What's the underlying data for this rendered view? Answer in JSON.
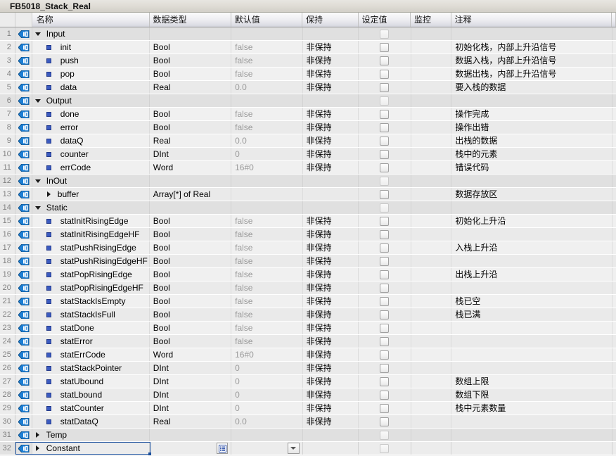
{
  "window": {
    "title": "FB5018_Stack_Real"
  },
  "table": {
    "columns": [
      {
        "key": "num",
        "label": ""
      },
      {
        "key": "icon",
        "label": ""
      },
      {
        "key": "name",
        "label": "名称"
      },
      {
        "key": "type",
        "label": "数据类型"
      },
      {
        "key": "def",
        "label": "默认值"
      },
      {
        "key": "ret",
        "label": "保持"
      },
      {
        "key": "set",
        "label": "设定值"
      },
      {
        "key": "mon",
        "label": "监控"
      },
      {
        "key": "com",
        "label": "注释"
      }
    ],
    "retain_value": "非保持",
    "icon_name": "variable-tag-icon",
    "rows": [
      {
        "n": "1",
        "kind": "section",
        "expanded": true,
        "indent": 0,
        "name": "Input",
        "type": "",
        "def": "",
        "ret": "",
        "com": ""
      },
      {
        "n": "2",
        "kind": "var",
        "expanded": false,
        "indent": 1,
        "name": "init",
        "type": "Bool",
        "def": "false",
        "ret": "非保持",
        "com": "初始化栈，内部上升沿信号"
      },
      {
        "n": "3",
        "kind": "var",
        "expanded": false,
        "indent": 1,
        "name": "push",
        "type": "Bool",
        "def": "false",
        "ret": "非保持",
        "com": "数据入栈，内部上升沿信号"
      },
      {
        "n": "4",
        "kind": "var",
        "expanded": false,
        "indent": 1,
        "name": "pop",
        "type": "Bool",
        "def": "false",
        "ret": "非保持",
        "com": "数据出栈，内部上升沿信号"
      },
      {
        "n": "5",
        "kind": "var",
        "expanded": false,
        "indent": 1,
        "name": "data",
        "type": "Real",
        "def": "0.0",
        "ret": "非保持",
        "com": "要入栈的数据"
      },
      {
        "n": "6",
        "kind": "section",
        "expanded": true,
        "indent": 0,
        "name": "Output",
        "type": "",
        "def": "",
        "ret": "",
        "com": ""
      },
      {
        "n": "7",
        "kind": "var",
        "expanded": false,
        "indent": 1,
        "name": "done",
        "type": "Bool",
        "def": "false",
        "ret": "非保持",
        "com": "操作完成"
      },
      {
        "n": "8",
        "kind": "var",
        "expanded": false,
        "indent": 1,
        "name": "error",
        "type": "Bool",
        "def": "false",
        "ret": "非保持",
        "com": "操作出错"
      },
      {
        "n": "9",
        "kind": "var",
        "expanded": false,
        "indent": 1,
        "name": "dataQ",
        "type": "Real",
        "def": "0.0",
        "ret": "非保持",
        "com": "出栈的数据"
      },
      {
        "n": "10",
        "kind": "var",
        "expanded": false,
        "indent": 1,
        "name": "counter",
        "type": "DInt",
        "def": "0",
        "ret": "非保持",
        "com": "栈中的元素"
      },
      {
        "n": "11",
        "kind": "var",
        "expanded": false,
        "indent": 1,
        "name": "errCode",
        "type": "Word",
        "def": "16#0",
        "ret": "非保持",
        "com": "错误代码"
      },
      {
        "n": "12",
        "kind": "section",
        "expanded": true,
        "indent": 0,
        "name": "InOut",
        "type": "",
        "def": "",
        "ret": "",
        "com": ""
      },
      {
        "n": "13",
        "kind": "var",
        "expanded": false,
        "indent": 1,
        "name": "buffer",
        "type": "Array[*] of Real",
        "def": "",
        "ret": "",
        "com": "数据存放区",
        "collapsible": true
      },
      {
        "n": "14",
        "kind": "section",
        "expanded": true,
        "indent": 0,
        "name": "Static",
        "type": "",
        "def": "",
        "ret": "",
        "com": ""
      },
      {
        "n": "15",
        "kind": "var",
        "expanded": false,
        "indent": 1,
        "name": "statInitRisingEdge",
        "type": "Bool",
        "def": "false",
        "ret": "非保持",
        "com": "初始化上升沿"
      },
      {
        "n": "16",
        "kind": "var",
        "expanded": false,
        "indent": 1,
        "name": "statInitRisingEdgeHF",
        "type": "Bool",
        "def": "false",
        "ret": "非保持",
        "com": ""
      },
      {
        "n": "17",
        "kind": "var",
        "expanded": false,
        "indent": 1,
        "name": "statPushRisingEdge",
        "type": "Bool",
        "def": "false",
        "ret": "非保持",
        "com": "入栈上升沿"
      },
      {
        "n": "18",
        "kind": "var",
        "expanded": false,
        "indent": 1,
        "name": "statPushRisingEdgeHF",
        "type": "Bool",
        "def": "false",
        "ret": "非保持",
        "com": ""
      },
      {
        "n": "19",
        "kind": "var",
        "expanded": false,
        "indent": 1,
        "name": "statPopRisingEdge",
        "type": "Bool",
        "def": "false",
        "ret": "非保持",
        "com": "出栈上升沿"
      },
      {
        "n": "20",
        "kind": "var",
        "expanded": false,
        "indent": 1,
        "name": "statPopRisingEdgeHF",
        "type": "Bool",
        "def": "false",
        "ret": "非保持",
        "com": ""
      },
      {
        "n": "21",
        "kind": "var",
        "expanded": false,
        "indent": 1,
        "name": "statStackIsEmpty",
        "type": "Bool",
        "def": "false",
        "ret": "非保持",
        "com": "栈已空"
      },
      {
        "n": "22",
        "kind": "var",
        "expanded": false,
        "indent": 1,
        "name": "statStackIsFull",
        "type": "Bool",
        "def": "false",
        "ret": "非保持",
        "com": "栈已满"
      },
      {
        "n": "23",
        "kind": "var",
        "expanded": false,
        "indent": 1,
        "name": "statDone",
        "type": "Bool",
        "def": "false",
        "ret": "非保持",
        "com": ""
      },
      {
        "n": "24",
        "kind": "var",
        "expanded": false,
        "indent": 1,
        "name": "statError",
        "type": "Bool",
        "def": "false",
        "ret": "非保持",
        "com": ""
      },
      {
        "n": "25",
        "kind": "var",
        "expanded": false,
        "indent": 1,
        "name": "statErrCode",
        "type": "Word",
        "def": "16#0",
        "ret": "非保持",
        "com": ""
      },
      {
        "n": "26",
        "kind": "var",
        "expanded": false,
        "indent": 1,
        "name": "statStackPointer",
        "type": "DInt",
        "def": "0",
        "ret": "非保持",
        "com": ""
      },
      {
        "n": "27",
        "kind": "var",
        "expanded": false,
        "indent": 1,
        "name": "statUbound",
        "type": "DInt",
        "def": "0",
        "ret": "非保持",
        "com": "数组上限"
      },
      {
        "n": "28",
        "kind": "var",
        "expanded": false,
        "indent": 1,
        "name": "statLbound",
        "type": "DInt",
        "def": "0",
        "ret": "非保持",
        "com": "数组下限"
      },
      {
        "n": "29",
        "kind": "var",
        "expanded": false,
        "indent": 1,
        "name": "statCounter",
        "type": "DInt",
        "def": "0",
        "ret": "非保持",
        "com": "栈中元素数量"
      },
      {
        "n": "30",
        "kind": "var",
        "expanded": false,
        "indent": 1,
        "name": "statDataQ",
        "type": "Real",
        "def": "0.0",
        "ret": "非保持",
        "com": ""
      },
      {
        "n": "31",
        "kind": "section",
        "expanded": false,
        "indent": 0,
        "name": "Temp",
        "type": "",
        "def": "",
        "ret": "",
        "com": ""
      },
      {
        "n": "32",
        "kind": "section",
        "expanded": false,
        "indent": 0,
        "name": "Constant",
        "type": "",
        "def": "",
        "ret": "",
        "com": "",
        "selected": true
      }
    ]
  },
  "colors": {
    "accent": "#1a4f9c",
    "tag_icon": "#1e7fd4",
    "section_bg": "#e0e0e0",
    "row_bg": "#f0f0f0",
    "row_alt_bg": "#eaeaea",
    "muted_text": "#9a9a9a"
  }
}
